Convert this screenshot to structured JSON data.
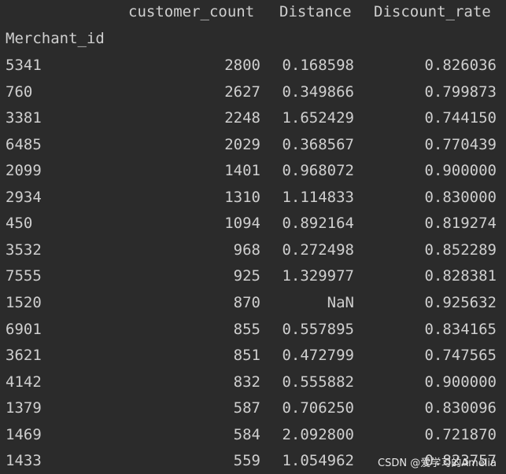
{
  "columns": {
    "customer_count": "customer_count",
    "distance": "Distance",
    "discount_rate": "Discount_rate"
  },
  "index_name": "Merchant_id",
  "rows": [
    {
      "merchant_id": "5341",
      "customer_count": "2800",
      "distance": "0.168598",
      "discount_rate": "0.826036"
    },
    {
      "merchant_id": "760",
      "customer_count": "2627",
      "distance": "0.349866",
      "discount_rate": "0.799873"
    },
    {
      "merchant_id": "3381",
      "customer_count": "2248",
      "distance": "1.652429",
      "discount_rate": "0.744150"
    },
    {
      "merchant_id": "6485",
      "customer_count": "2029",
      "distance": "0.368567",
      "discount_rate": "0.770439"
    },
    {
      "merchant_id": "2099",
      "customer_count": "1401",
      "distance": "0.968072",
      "discount_rate": "0.900000"
    },
    {
      "merchant_id": "2934",
      "customer_count": "1310",
      "distance": "1.114833",
      "discount_rate": "0.830000"
    },
    {
      "merchant_id": "450",
      "customer_count": "1094",
      "distance": "0.892164",
      "discount_rate": "0.819274"
    },
    {
      "merchant_id": "3532",
      "customer_count": "968",
      "distance": "0.272498",
      "discount_rate": "0.852289"
    },
    {
      "merchant_id": "7555",
      "customer_count": "925",
      "distance": "1.329977",
      "discount_rate": "0.828381"
    },
    {
      "merchant_id": "1520",
      "customer_count": "870",
      "distance": "NaN",
      "discount_rate": "0.925632"
    },
    {
      "merchant_id": "6901",
      "customer_count": "855",
      "distance": "0.557895",
      "discount_rate": "0.834165"
    },
    {
      "merchant_id": "3621",
      "customer_count": "851",
      "distance": "0.472799",
      "discount_rate": "0.747565"
    },
    {
      "merchant_id": "4142",
      "customer_count": "832",
      "distance": "0.555882",
      "discount_rate": "0.900000"
    },
    {
      "merchant_id": "1379",
      "customer_count": "587",
      "distance": "0.706250",
      "discount_rate": "0.830096"
    },
    {
      "merchant_id": "1469",
      "customer_count": "584",
      "distance": "2.092800",
      "discount_rate": "0.721870"
    },
    {
      "merchant_id": "1433",
      "customer_count": "559",
      "distance": "1.054962",
      "discount_rate": "0.823757"
    }
  ],
  "watermark": "CSDN @爱学习的Amelia",
  "colors": {
    "background": "#2b2b2b",
    "text": "#cfcfcf",
    "watermark": "#e8e8e8"
  }
}
